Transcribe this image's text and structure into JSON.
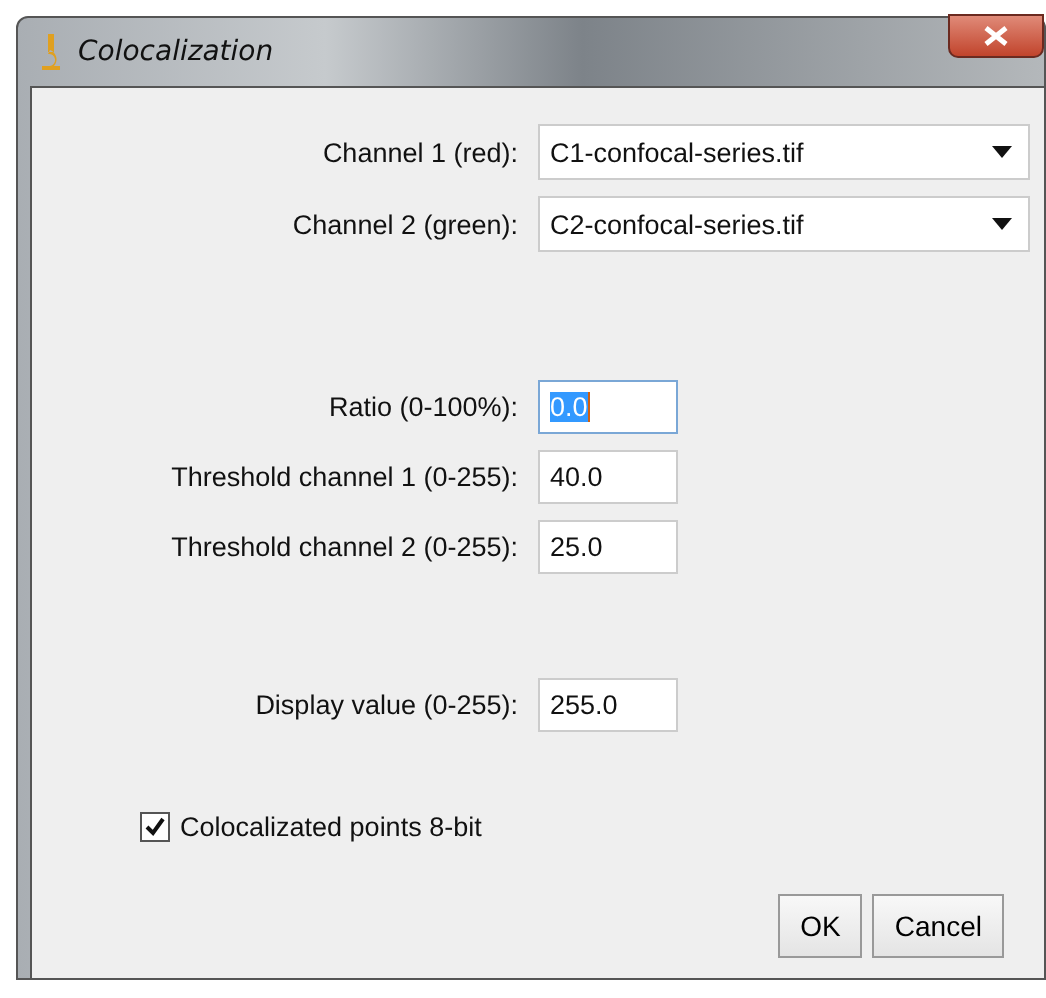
{
  "window": {
    "title": "Colocalization"
  },
  "groups": [
    {
      "fields": [
        {
          "kind": "dropdown",
          "label": "Channel 1 (red):",
          "value": "C1-confocal-series.tif"
        },
        {
          "kind": "dropdown",
          "label": "Channel 2 (green):",
          "value": "C2-confocal-series.tif"
        }
      ]
    },
    {
      "fields": [
        {
          "kind": "number",
          "label": "Ratio (0-100%):",
          "value": "0.0",
          "focused": true
        },
        {
          "kind": "number",
          "label": "Threshold channel 1 (0-255):",
          "value": "40.0",
          "focused": false
        },
        {
          "kind": "number",
          "label": "Threshold channel 2 (0-255):",
          "value": "25.0",
          "focused": false
        }
      ]
    },
    {
      "fields": [
        {
          "kind": "number",
          "label": "Display value (0-255):",
          "value": "255.0",
          "focused": false
        }
      ]
    }
  ],
  "checkbox": {
    "label": "Colocalizated points 8-bit",
    "checked": true
  },
  "buttons": [
    "OK",
    "Cancel"
  ]
}
